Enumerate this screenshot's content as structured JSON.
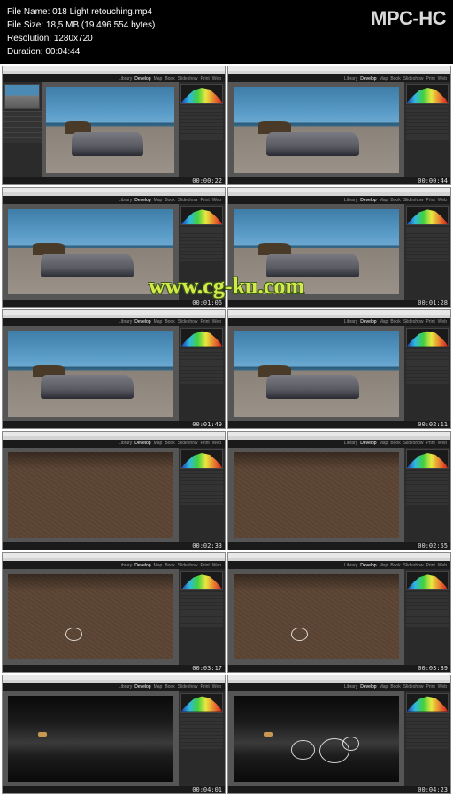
{
  "app": {
    "name": "MPC-HC"
  },
  "info": {
    "filename_label": "File Name:",
    "filename": "018 Light retouching.mp4",
    "filesize_label": "File Size:",
    "filesize": "18,5 MB (19 496 554 bytes)",
    "resolution_label": "Resolution:",
    "resolution": "1280x720",
    "duration_label": "Duration:",
    "duration": "00:04:44"
  },
  "watermark": "www.cg-ku.com",
  "modules": [
    "Library",
    "Develop",
    "Map",
    "Book",
    "Slideshow",
    "Print",
    "Web"
  ],
  "active_module": "Develop",
  "thumbs": [
    {
      "ts": "00:00:22",
      "scene": "car",
      "left": true
    },
    {
      "ts": "00:00:44",
      "scene": "car",
      "left": false
    },
    {
      "ts": "00:01:06",
      "scene": "car",
      "left": false
    },
    {
      "ts": "00:01:28",
      "scene": "car",
      "left": false
    },
    {
      "ts": "00:01:49",
      "scene": "car",
      "left": false
    },
    {
      "ts": "00:02:11",
      "scene": "car",
      "left": false
    },
    {
      "ts": "00:02:33",
      "scene": "ground",
      "left": false
    },
    {
      "ts": "00:02:55",
      "scene": "ground",
      "left": false
    },
    {
      "ts": "00:03:17",
      "scene": "ground",
      "left": false
    },
    {
      "ts": "00:03:39",
      "scene": "ground",
      "left": false
    },
    {
      "ts": "00:04:01",
      "scene": "dark",
      "left": false
    },
    {
      "ts": "00:04:23",
      "scene": "dark",
      "left": false
    }
  ]
}
